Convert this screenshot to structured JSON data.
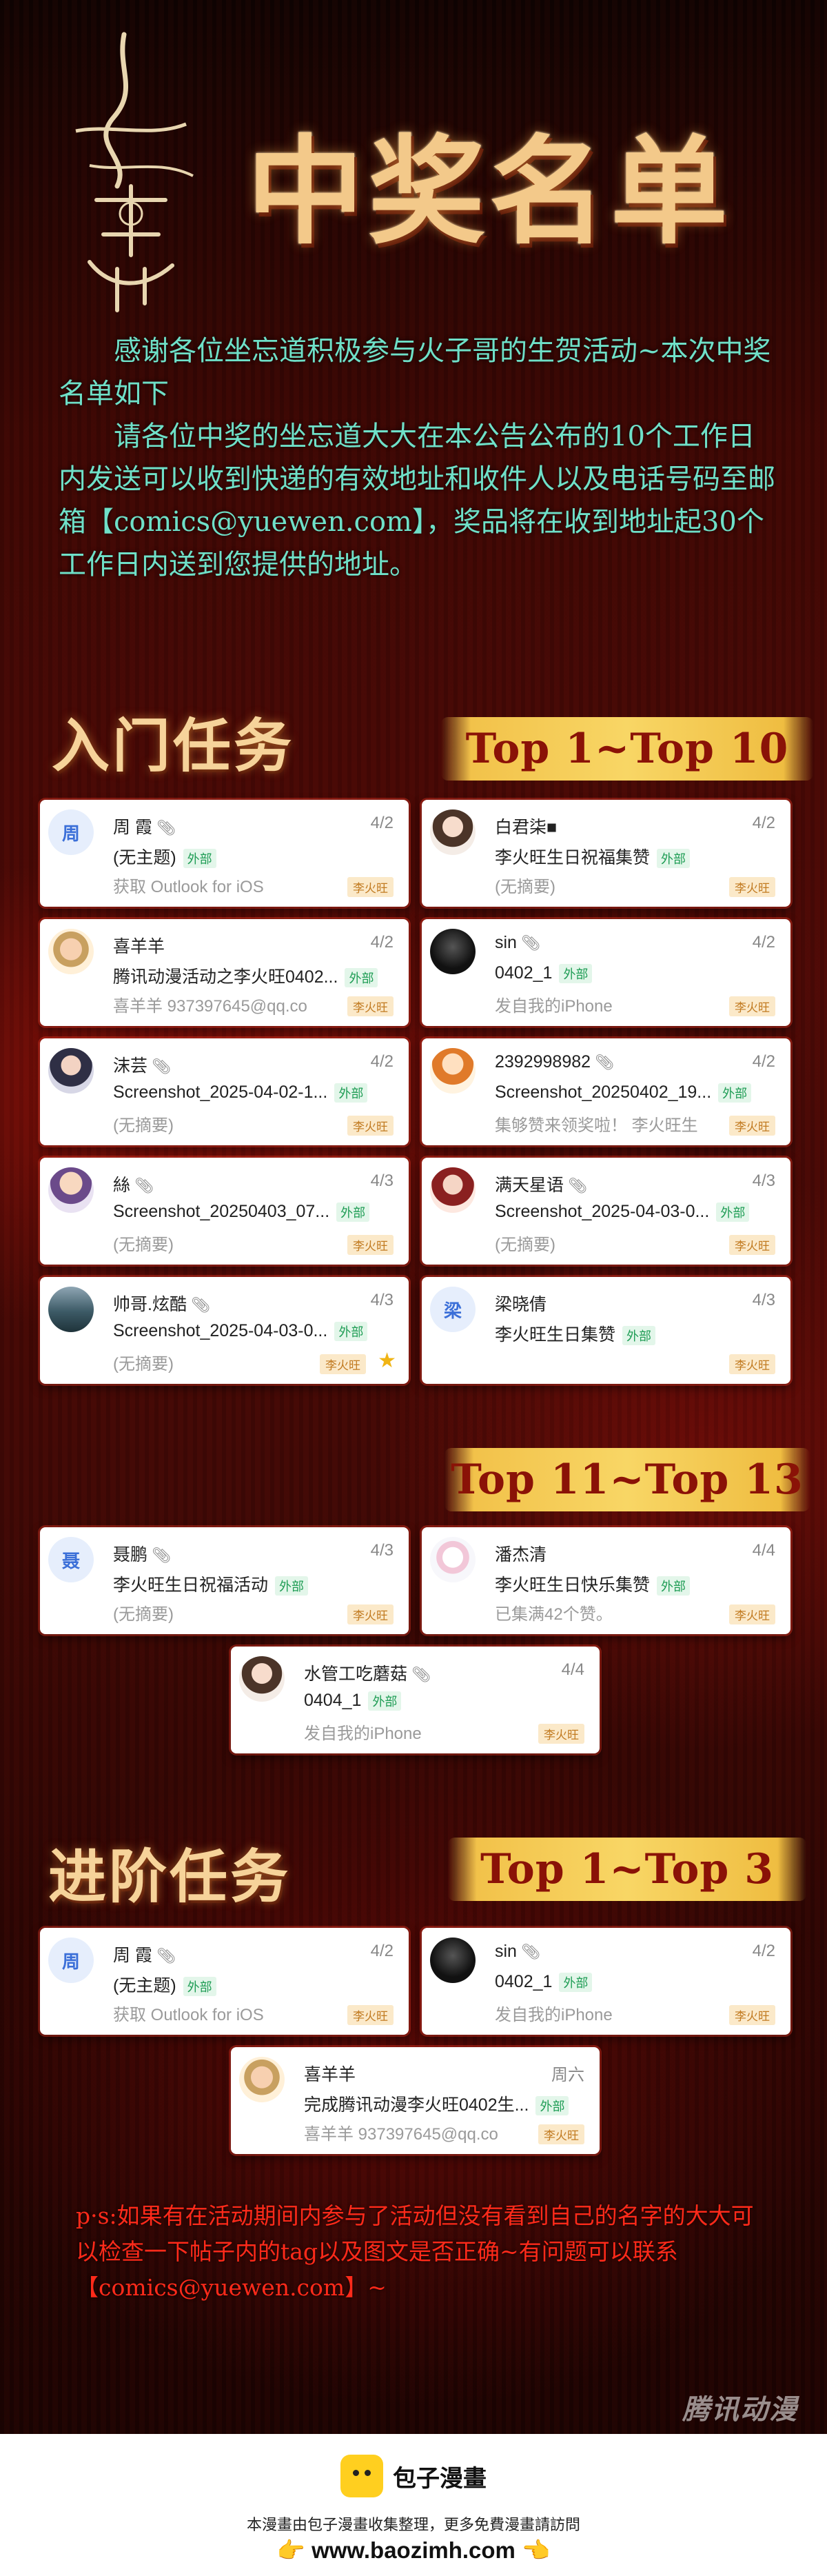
{
  "header": {
    "logo_text": "道诡异仙",
    "title": "中奖名单"
  },
  "intro": {
    "p1": "感谢各位坐忘道积极参与火子哥的生贺活动~本次中奖名单如下",
    "p2": "请各位中奖的坐忘道大大在本公告公布的10个工作日内发送可以收到快递的有效地址和收件人以及电话号码至邮箱【comics@yuewen.com】，奖品将在收到地址起30个工作日内送到您提供的地址。"
  },
  "sections": {
    "entry_title": "入门任务",
    "entry_banner1": "Top 1~Top 10",
    "entry_banner2": "Top 11~Top 13",
    "advanced_title": "进阶任务",
    "advanced_banner": "Top 1~Top 3"
  },
  "external_label": "外部",
  "tag_label": "李火旺",
  "cards": [
    {
      "avatar": "周",
      "name": "周 霞",
      "date": "4/2",
      "subject": "(无主题)",
      "preview": "获取 Outlook for iOS"
    },
    {
      "name": "白君柒■",
      "date": "4/2",
      "subject": "李火旺生日祝福集赞",
      "preview": "(无摘要)"
    },
    {
      "name": "喜羊羊",
      "date": "4/2",
      "subject": "腾讯动漫活动之李火旺0402...",
      "preview": "喜羊羊 937397645@qq.co"
    },
    {
      "name": "sin",
      "date": "4/2",
      "subject": "0402_1",
      "preview": "发自我的iPhone"
    },
    {
      "name": "沫芸",
      "date": "4/2",
      "subject": "Screenshot_2025-04-02-1...",
      "preview": "(无摘要)"
    },
    {
      "name": "2392998982",
      "date": "4/2",
      "subject": "Screenshot_20250402_19...",
      "preview": "集够赞来领奖啦！ 李火旺生"
    },
    {
      "name": "絲",
      "date": "4/3",
      "subject": "Screenshot_20250403_07...",
      "preview": "(无摘要)"
    },
    {
      "name": "满天星语",
      "date": "4/3",
      "subject": "Screenshot_2025-04-03-0...",
      "preview": "(无摘要)"
    },
    {
      "name": "帅哥.炫酷",
      "date": "4/3",
      "subject": "Screenshot_2025-04-03-0...",
      "preview": "(无摘要)"
    },
    {
      "avatar": "梁",
      "name": "梁晓倩",
      "date": "4/3",
      "subject": "李火旺生日集赞",
      "preview": ""
    },
    {
      "avatar": "聂",
      "name": "聂鹏",
      "date": "4/3",
      "subject": "李火旺生日祝福活动",
      "preview": "(无摘要)"
    },
    {
      "name": "潘杰清",
      "date": "4/4",
      "subject": "李火旺生日快乐集赞",
      "preview": "已集满42个赞。"
    },
    {
      "name": "水管工吃蘑菇",
      "date": "4/4",
      "subject": "0404_1",
      "preview": "发自我的iPhone"
    },
    {
      "avatar": "周",
      "name": "周 霞",
      "date": "4/2",
      "subject": "(无主题)",
      "preview": "获取 Outlook for iOS"
    },
    {
      "name": "sin",
      "date": "4/2",
      "subject": "0402_1",
      "preview": "发自我的iPhone"
    },
    {
      "name": "喜羊羊",
      "date": "周六",
      "subject": "完成腾讯动漫李火旺0402生...",
      "preview": "喜羊羊 937397645@qq.co"
    }
  ],
  "ps": "p·s:如果有在活动期间内参与了活动但没有看到自己的名字的大大可以检查一下帖子内的tag以及图文是否正确~有问题可以联系【comics@yuewen.com】~",
  "watermark": "腾讯动漫",
  "footer": {
    "brand": "包子漫畫",
    "note": "本漫畫由包子漫畫收集整理，更多免費漫畫請訪問",
    "hand_left": "👉",
    "url": "www.baozimh.com",
    "hand_right": "👈"
  }
}
